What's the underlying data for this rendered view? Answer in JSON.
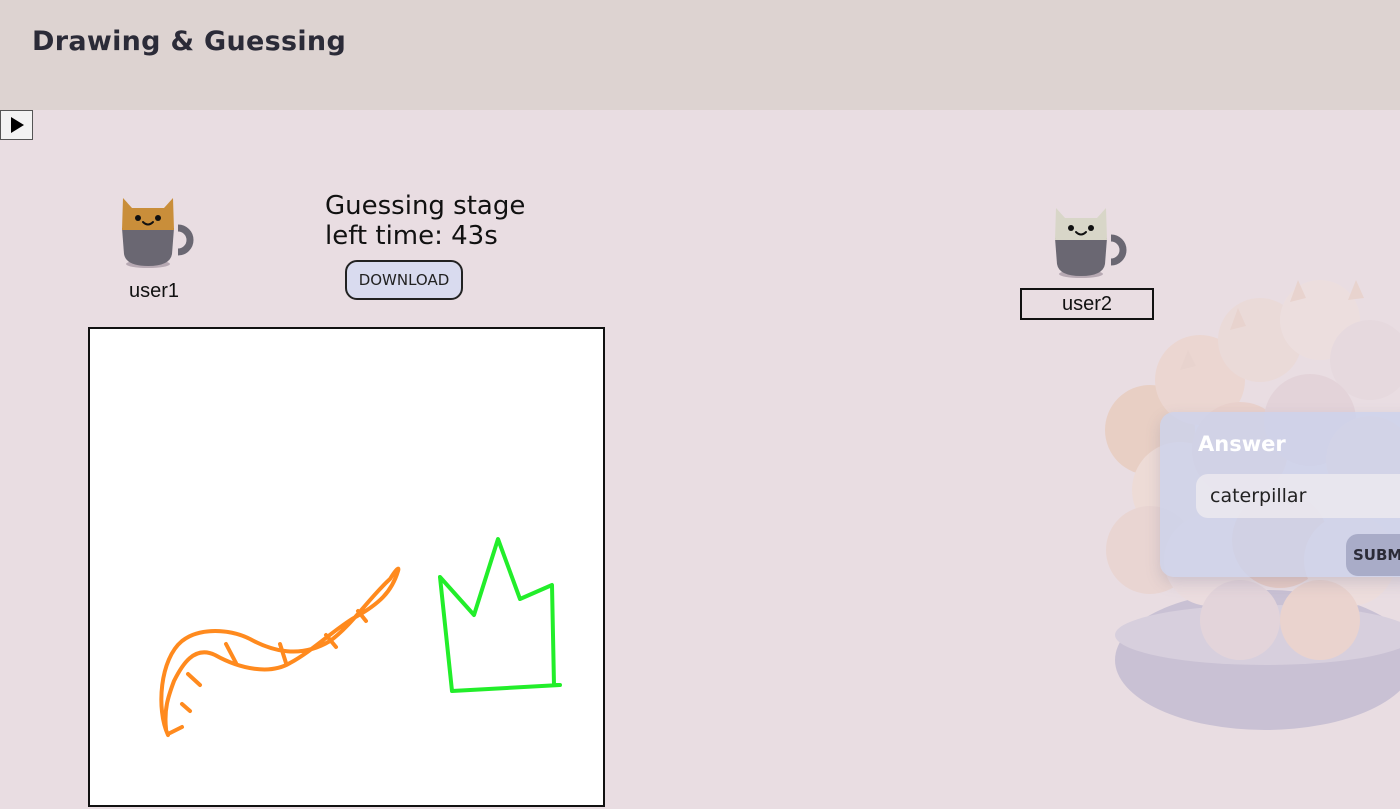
{
  "app": {
    "title": "Drawing & Guessing"
  },
  "controls": {
    "play_icon": "play-icon"
  },
  "players": [
    {
      "name": "user1",
      "avatar": "cat-cup-icon",
      "color": "#c98e3a"
    },
    {
      "name": "user2",
      "avatar": "cat-cup-icon",
      "color": "#d8d6c8"
    }
  ],
  "game": {
    "stage": "Guessing stage",
    "time_left": "left time: 43s",
    "download_label": "DOWNLOAD"
  },
  "drawing": {
    "strokes": [
      {
        "name": "caterpillar",
        "color": "#ff8a1e"
      },
      {
        "name": "crown",
        "color": "#22ee2a"
      }
    ]
  },
  "answer": {
    "label": "Answer",
    "value": "caterpillar",
    "submit_label": "SUBMIT"
  },
  "colors": {
    "background": "#e9dde2",
    "header": "#ddd3d1",
    "card": "#ccd2ec",
    "cup": "#6a6772"
  }
}
